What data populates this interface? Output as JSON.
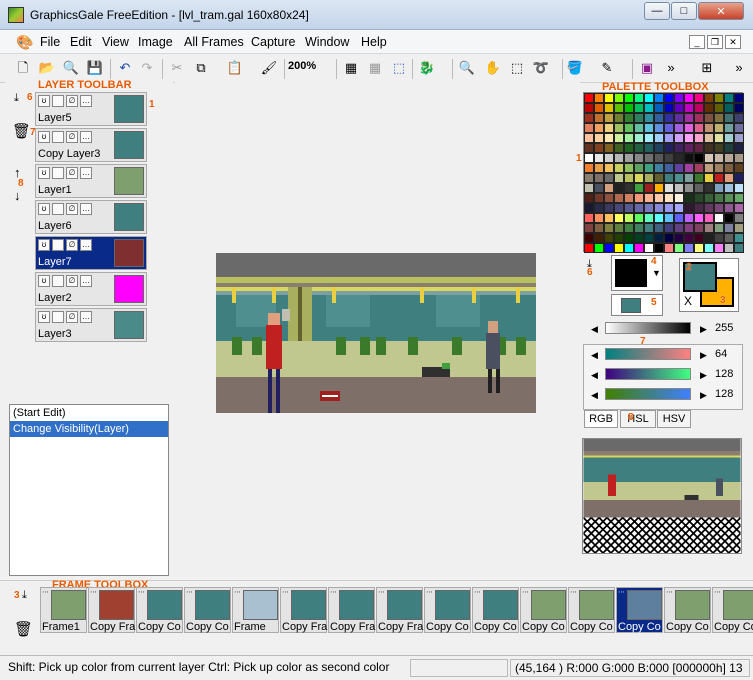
{
  "window": {
    "title": "GraphicsGale FreeEdition - [lvl_tram.gal 160x80x24]",
    "minimize": "—",
    "maximize": "□",
    "close": "✕"
  },
  "menu": {
    "items": [
      "File",
      "Edit",
      "View",
      "Image",
      "All Frames",
      "Capture",
      "Window",
      "Help"
    ],
    "mdi_minimize": "_",
    "mdi_restore": "❐",
    "mdi_close": "✕"
  },
  "toolbar": {
    "zoom": "200%"
  },
  "annotations": {
    "layer_toolbar": "LAYER TOOLBAR",
    "palette_toolbox": "PALETTE TOOLBOX",
    "frame_toolbox": "FRAME TOOLBOX",
    "n1": "1",
    "n2": "2",
    "n3": "3",
    "n4": "4",
    "n5": "5",
    "n6": "6",
    "n7": "7",
    "n8": "8"
  },
  "layers": [
    {
      "name": "Layer5",
      "thumb": "#3f7f7f"
    },
    {
      "name": "Copy  Layer3",
      "thumb": "#3f7f7f"
    },
    {
      "name": "Layer1",
      "thumb": "#7f9f6f"
    },
    {
      "name": "Layer6",
      "thumb": "#3f7f7f"
    },
    {
      "name": "Layer7",
      "thumb": "#7f2f2f",
      "selected": true
    },
    {
      "name": "Layer2",
      "thumb": "#ff00ff"
    },
    {
      "name": "Layer3",
      "thumb": "#4a8a88"
    }
  ],
  "history": {
    "items": [
      "(Start Edit)",
      "Change Visibility(Layer)"
    ]
  },
  "palette": {
    "primary_color": "#000000",
    "secondary_color": "#ffb000",
    "fg_swatch": "#3f7f7f",
    "bg_swatch": "#ffb000",
    "x_label": "X",
    "brightness_value": "255",
    "rgb_values": [
      "64",
      "128",
      "128"
    ],
    "tabs": [
      "RGB",
      "HSL",
      "HSV"
    ]
  },
  "frames": [
    {
      "label": "Frame1"
    },
    {
      "label": "Copy  Fra"
    },
    {
      "label": "Copy  Co"
    },
    {
      "label": "Copy  Co"
    },
    {
      "label": "Frame"
    },
    {
      "label": "Copy  Fra"
    },
    {
      "label": "Copy  Fra"
    },
    {
      "label": "Copy  Fra"
    },
    {
      "label": "Copy  Co"
    },
    {
      "label": "Copy  Co"
    },
    {
      "label": "Copy  Co"
    },
    {
      "label": "Copy  Co"
    },
    {
      "label": "Copy  Co",
      "selected": true
    },
    {
      "label": "Copy  Co"
    },
    {
      "label": "Copy  Co"
    }
  ],
  "status": {
    "hint": "Shift: Pick up color from current layer  Ctrl: Pick up color as second color",
    "coords": "(45,164 ) R:000 G:000 B:000  [000000h]  13"
  }
}
